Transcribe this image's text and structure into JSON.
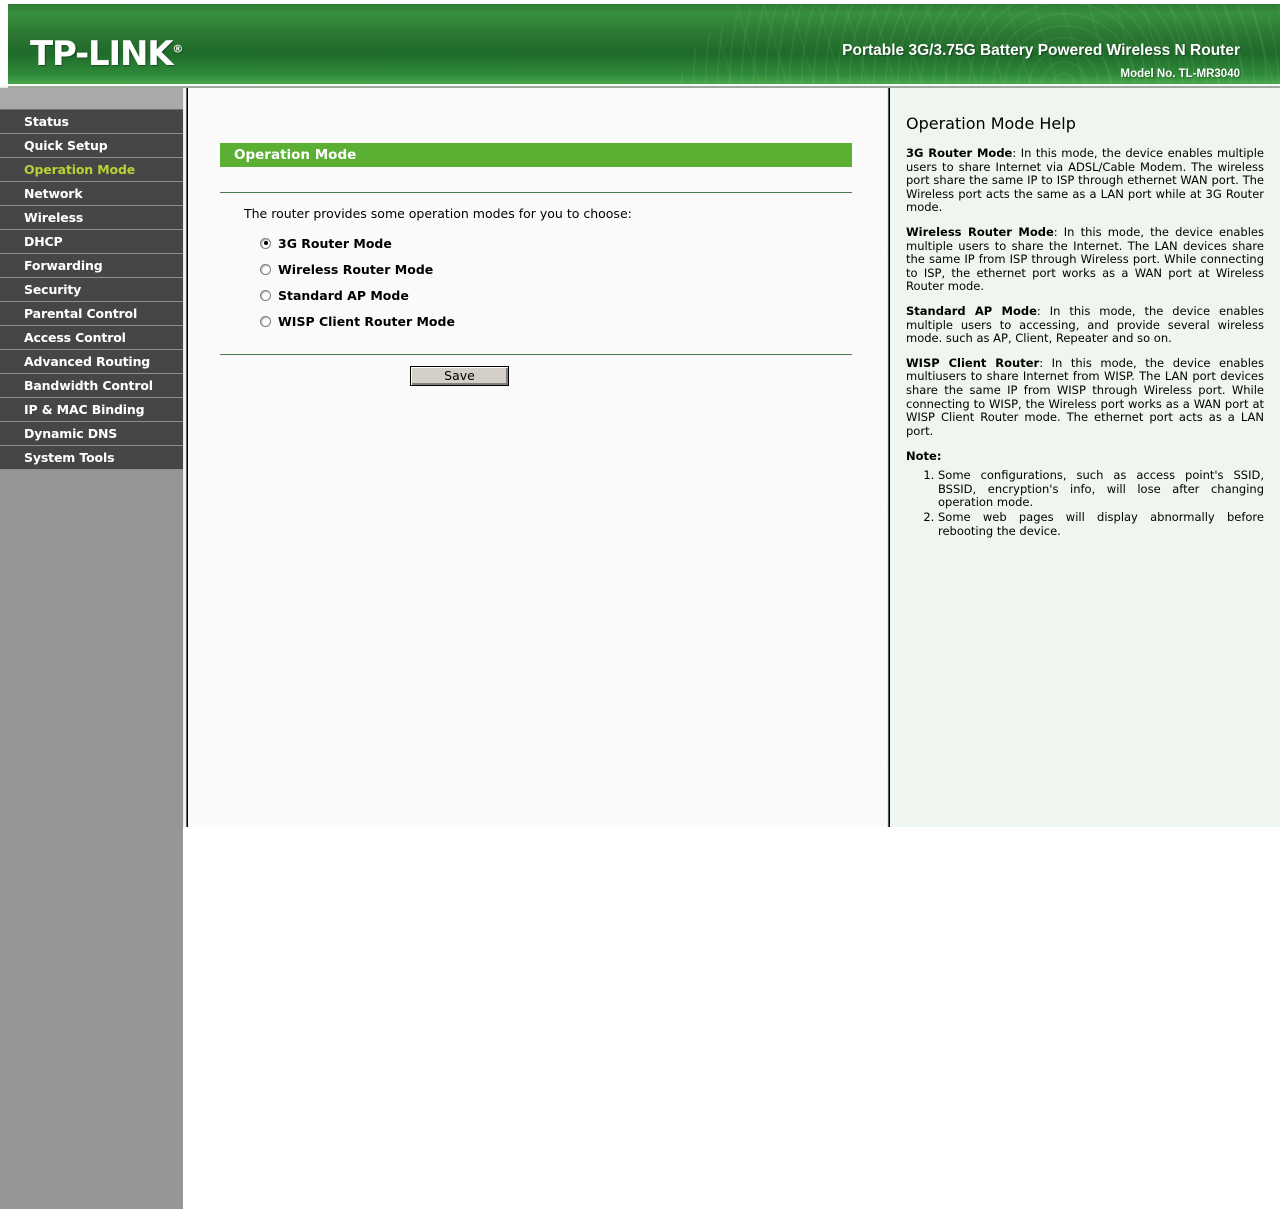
{
  "header": {
    "logo_text": "TP-LINK",
    "logo_mark": "®",
    "product_name": "Portable 3G/3.75G Battery Powered Wireless N Router",
    "model": "Model No. TL-MR3040",
    "brand_green": "#2b7531",
    "accent_green": "#5bb033"
  },
  "sidebar": {
    "active_color": "#b5d334",
    "items": [
      {
        "label": "Status",
        "active": false
      },
      {
        "label": "Quick Setup",
        "active": false
      },
      {
        "label": "Operation Mode",
        "active": true
      },
      {
        "label": "Network",
        "active": false
      },
      {
        "label": "Wireless",
        "active": false
      },
      {
        "label": "DHCP",
        "active": false
      },
      {
        "label": "Forwarding",
        "active": false
      },
      {
        "label": "Security",
        "active": false
      },
      {
        "label": "Parental Control",
        "active": false
      },
      {
        "label": "Access Control",
        "active": false
      },
      {
        "label": "Advanced Routing",
        "active": false
      },
      {
        "label": "Bandwidth Control",
        "active": false
      },
      {
        "label": "IP & MAC Binding",
        "active": false
      },
      {
        "label": "Dynamic DNS",
        "active": false
      },
      {
        "label": "System Tools",
        "active": false
      }
    ]
  },
  "main": {
    "section_title": "Operation Mode",
    "intro": "The router provides some operation modes for you to choose:",
    "modes": [
      {
        "label": "3G Router Mode",
        "checked": true
      },
      {
        "label": "Wireless Router Mode",
        "checked": false
      },
      {
        "label": "Standard AP Mode",
        "checked": false
      },
      {
        "label": "WISP Client Router Mode",
        "checked": false
      }
    ],
    "save_label": "Save"
  },
  "help": {
    "title": "Operation Mode Help",
    "paragraphs": [
      {
        "term": "3G Router Mode",
        "text": ": In this mode, the device enables multiple users to share Internet via ADSL/Cable Modem. The wireless port share the same IP to ISP through ethernet WAN port. The Wireless port acts the same as a LAN port while at 3G Router mode."
      },
      {
        "term": "Wireless Router Mode",
        "text": ": In this mode, the device enables multiple users to share the Internet. The LAN devices share the same IP from ISP through Wireless port. While connecting to ISP, the ethernet port works as a WAN port at Wireless Router mode."
      },
      {
        "term": "Standard AP Mode",
        "text": ": In this mode, the device enables multiple users to accessing, and provide several wireless mode. such as AP, Client, Repeater and so on."
      },
      {
        "term": "WISP Client Router",
        "text": ": In this mode, the device enables multiusers to share Internet from WISP. The LAN port devices share the same IP from WISP through Wireless port. While connecting to WISP, the Wireless port works as a WAN port at WISP Client Router mode. The ethernet port acts as a LAN port."
      }
    ],
    "note_label": "Note:",
    "notes": [
      "Some configurations, such as access point's SSID, BSSID, encryption's info, will lose after changing operation mode.",
      "Some web pages will display abnormally before rebooting the device."
    ]
  }
}
